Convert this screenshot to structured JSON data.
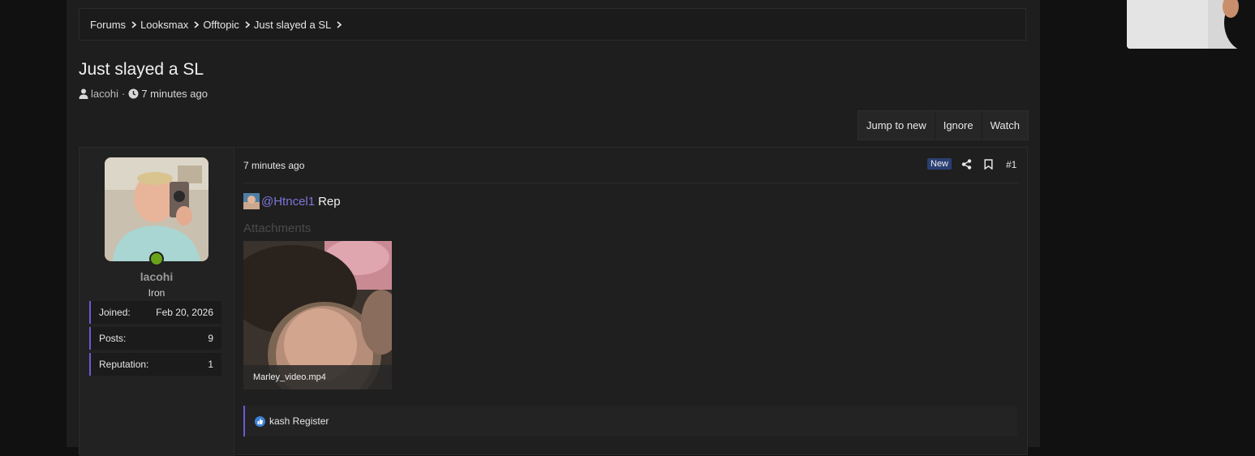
{
  "breadcrumb": {
    "items": [
      "Forums",
      "Looksmax",
      "Offtopic",
      "Just slayed a SL"
    ]
  },
  "thread": {
    "title": "Just slayed a SL",
    "author": "lacohi",
    "separator": "·",
    "time": "7 minutes ago"
  },
  "actions": {
    "jump": "Jump to new",
    "ignore": "Ignore",
    "watch": "Watch"
  },
  "user": {
    "name": "lacohi",
    "rank": "Iron",
    "online_color": "#6aa31a",
    "stats": [
      {
        "label": "Joined:",
        "value": "Feb 20, 2026"
      },
      {
        "label": "Posts:",
        "value": "9"
      },
      {
        "label": "Reputation:",
        "value": "1"
      }
    ]
  },
  "post": {
    "time": "7 minutes ago",
    "badge": "New",
    "number": "#1",
    "mention": "@Htncel1",
    "message": "Rep",
    "attachments_label": "Attachments",
    "attachment_name": "Marley_video.mp4",
    "reactions": "kash Register"
  },
  "icons": {
    "author": "user-icon",
    "time": "clock-icon",
    "share": "share-icon",
    "bookmark": "bookmark-icon",
    "like": "like-icon"
  },
  "colors": {
    "accent": "#6a5ad6",
    "mention": "#7d76d9",
    "badge": "#2b3f73"
  }
}
